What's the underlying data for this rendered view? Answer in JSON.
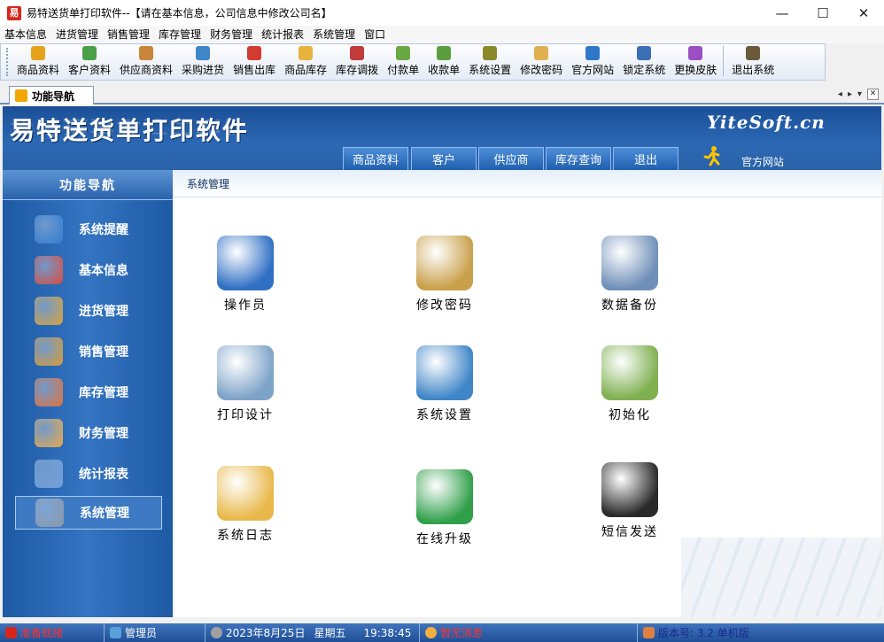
{
  "window": {
    "app_icon_text": "易",
    "title": "易特送货单打印软件--【请在基本信息，公司信息中修改公司名】",
    "min_glyph": "—",
    "max_glyph": "☐",
    "close_glyph": "✕"
  },
  "menu": [
    "基本信息",
    "进货管理",
    "销售管理",
    "库存管理",
    "财务管理",
    "统计报表",
    "系统管理",
    "窗口"
  ],
  "toolbar": [
    {
      "label": "商品资料",
      "icon": "goods-icon",
      "color": "#e5a21c"
    },
    {
      "label": "客户资料",
      "icon": "customer-icon",
      "color": "#4aa047"
    },
    {
      "label": "供应商资料",
      "icon": "supplier-icon",
      "color": "#c9853a"
    },
    {
      "label": "采购进货",
      "icon": "purchase-icon",
      "color": "#3f86c8"
    },
    {
      "label": "销售出库",
      "icon": "sales-icon",
      "color": "#d23b2f"
    },
    {
      "label": "商品库存",
      "icon": "stock-icon",
      "color": "#e8b33d"
    },
    {
      "label": "库存调拨",
      "icon": "transfer-icon",
      "color": "#c23b3b"
    },
    {
      "label": "付款单",
      "icon": "payment-icon",
      "color": "#6aa844"
    },
    {
      "label": "收款单",
      "icon": "receipt-icon",
      "color": "#5a9e40"
    },
    {
      "label": "系统设置",
      "icon": "settings-icon",
      "color": "#8a8a2a"
    },
    {
      "label": "修改密码",
      "icon": "password-icon",
      "color": "#e0b050"
    },
    {
      "label": "官方网站",
      "icon": "ie-icon",
      "color": "#2f78c8"
    },
    {
      "label": "锁定系统",
      "icon": "lock-icon",
      "color": "#3b6fb5"
    },
    {
      "label": "更换皮肤",
      "icon": "skin-icon",
      "color": "#9c4fc0"
    },
    {
      "label": "退出系统",
      "icon": "exit-icon",
      "color": "#6b5a3a"
    }
  ],
  "tab": {
    "label": "功能导航",
    "prev": "◂",
    "next": "▸",
    "menu": "▾",
    "close": "✕"
  },
  "banner": {
    "title": "易特送货单打印软件",
    "brand": "YiteSoft.cn",
    "tabs": [
      "商品资料",
      "客户",
      "供应商",
      "库存查询",
      "退出"
    ],
    "official_site": "官方网站"
  },
  "leftnav": {
    "title": "功能导航",
    "items": [
      {
        "label": "系统提醒",
        "icon": "info-icon",
        "color": "#2f7cd0"
      },
      {
        "label": "基本信息",
        "icon": "cubes-icon",
        "color": "#d94a3c"
      },
      {
        "label": "进货管理",
        "icon": "box-in-icon",
        "color": "#d8a23c"
      },
      {
        "label": "销售管理",
        "icon": "box-out-icon",
        "color": "#d89a34"
      },
      {
        "label": "库存管理",
        "icon": "warehouse-icon",
        "color": "#e0703a"
      },
      {
        "label": "财务管理",
        "icon": "finance-icon",
        "color": "#e8a84a"
      },
      {
        "label": "统计报表",
        "icon": "chart-icon",
        "color": "#6f9fd8"
      },
      {
        "label": "系统管理",
        "icon": "gears-icon",
        "color": "#8c97a8"
      }
    ],
    "active_index": 7
  },
  "content": {
    "header": "系统管理",
    "tiles": [
      {
        "label": "操作员",
        "icon": "operator-icon",
        "color": "#2f6fc4"
      },
      {
        "label": "修改密码",
        "icon": "change-password-icon",
        "color": "#c9a04a"
      },
      {
        "label": "数据备份",
        "icon": "backup-icon",
        "color": "#6f8fb8"
      },
      {
        "label": "打印设计",
        "icon": "print-design-icon",
        "color": "#7ea3c8"
      },
      {
        "label": "系统设置",
        "icon": "system-settings-icon",
        "color": "#3f86c8"
      },
      {
        "label": "初始化",
        "icon": "initialize-icon",
        "color": "#7fb050"
      },
      {
        "label": "系统日志",
        "icon": "system-log-icon",
        "color": "#e8b84a"
      },
      {
        "label": "在线升级",
        "icon": "online-upgrade-icon",
        "color": "#2f9f4a"
      },
      {
        "label": "短信发送",
        "icon": "sms-icon",
        "color": "#2a2a2a"
      }
    ]
  },
  "statusbar": {
    "ready": "准备就绪",
    "user": "管理员",
    "date": "2023年8月25日",
    "weekday": "星期五",
    "time": "19:38:45",
    "message": "暂无消息",
    "version": "版本号: 3.2 单机版"
  }
}
